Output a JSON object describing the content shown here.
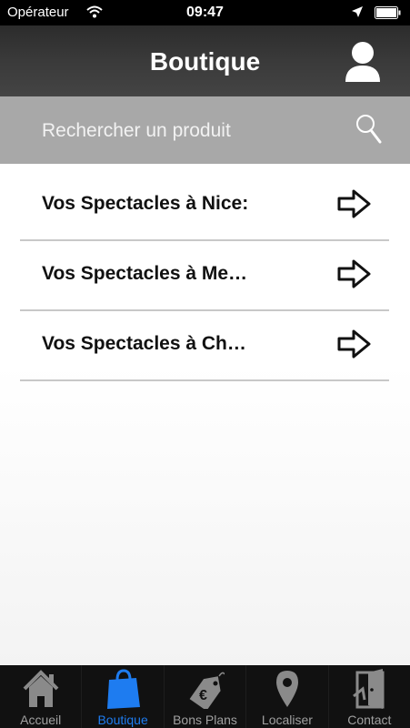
{
  "status_bar": {
    "carrier": "Opérateur",
    "time": "09:47"
  },
  "header": {
    "title": "Boutique",
    "account_icon": "user-icon"
  },
  "search": {
    "placeholder": "Rechercher un produit",
    "icon": "magnifier-icon"
  },
  "list": {
    "items": [
      {
        "label": "Vos Spectacles à Nice:",
        "icon": "arrow-right-icon"
      },
      {
        "label": "Vos Spectacles à Me…",
        "icon": "arrow-right-icon"
      },
      {
        "label": "Vos Spectacles à Ch…",
        "icon": "arrow-right-icon"
      }
    ]
  },
  "tab_bar": {
    "active_color": "#1e7cf0",
    "tabs": [
      {
        "label": "Accueil",
        "icon": "home-icon",
        "active": false
      },
      {
        "label": "Boutique",
        "icon": "shopping-bag-icon",
        "active": true
      },
      {
        "label": "Bons Plans",
        "icon": "euro-tag-icon",
        "active": false
      },
      {
        "label": "Localiser",
        "icon": "location-pin-icon",
        "active": false
      },
      {
        "label": "Contact",
        "icon": "door-icon",
        "active": false
      }
    ]
  }
}
